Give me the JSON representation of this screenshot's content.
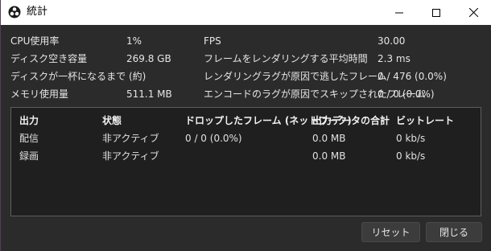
{
  "window": {
    "title": "統計"
  },
  "stats": {
    "left": [
      {
        "label": "CPU使用率",
        "value": "1%"
      },
      {
        "label": "ディスク空き容量",
        "value": "269.8 GB"
      },
      {
        "label": "ディスクが一杯になるまで (約)",
        "value": ""
      },
      {
        "label": "メモリ使用量",
        "value": "511.1 MB"
      }
    ],
    "right": [
      {
        "label": "FPS",
        "value": "30.00"
      },
      {
        "label": "フレームをレンダリングする平均時間",
        "value": "2.3 ms"
      },
      {
        "label": "レンダリングラグが原因で逃したフレーム",
        "value": "0 / 476 (0.0%)"
      },
      {
        "label": "エンコードのラグが原因でスキップされたフレーム",
        "value": "0 / 0 (0.0%)"
      }
    ]
  },
  "output_table": {
    "headers": [
      "出力",
      "状態",
      "ドロップしたフレーム (ネットワーク)",
      "出力データの合計",
      "ビットレート"
    ],
    "rows": [
      [
        "配信",
        "非アクティブ",
        "0 / 0 (0.0%)",
        "0.0 MB",
        "0 kb/s"
      ],
      [
        "録画",
        "非アクティブ",
        "",
        "0.0 MB",
        "0 kb/s"
      ]
    ]
  },
  "buttons": {
    "reset": "リセット",
    "close": "閉じる"
  },
  "colors": {
    "window_bg": "#2b2b2b",
    "titlebar_bg": "#ffffff",
    "table_bg": "#1f1f1f",
    "text": "#e6e6e6"
  },
  "icons": {
    "app": "obs-logo-icon",
    "minimize": "minimize-icon",
    "maximize": "maximize-icon",
    "close": "close-icon"
  }
}
